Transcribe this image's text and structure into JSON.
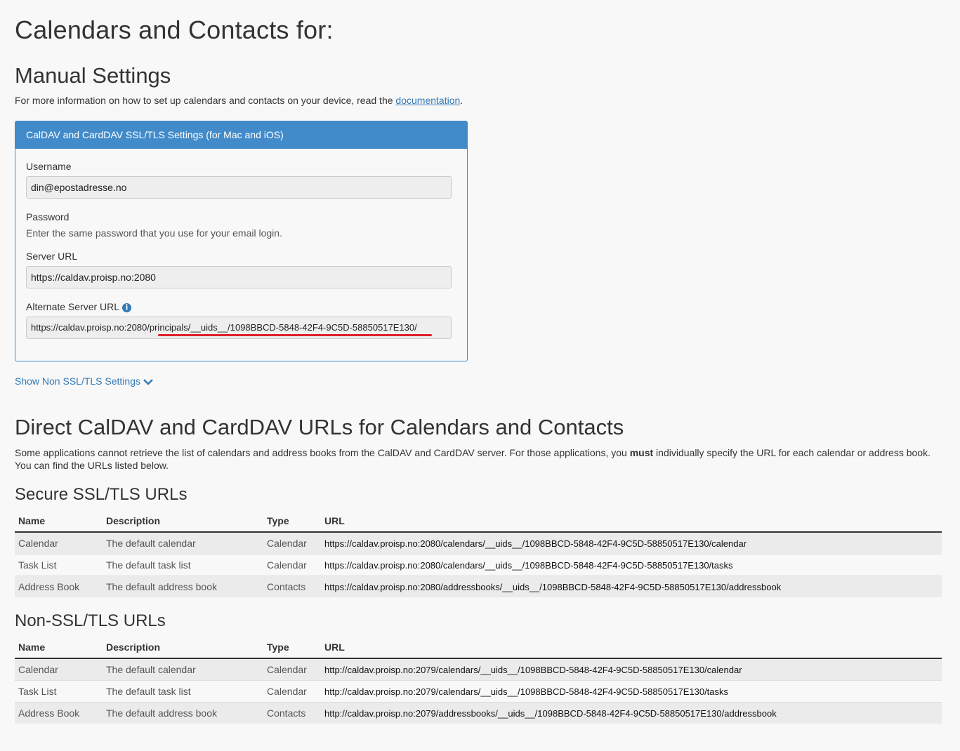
{
  "page_title": "Calendars and Contacts for:",
  "manual": {
    "heading": "Manual Settings",
    "intro_before": "For more information on how to set up calendars and contacts on your device, read the ",
    "intro_link": "documentation",
    "intro_after": "."
  },
  "panel": {
    "header": "CalDAV and CardDAV SSL/TLS Settings (for Mac and iOS)",
    "username_label": "Username",
    "username_value": "din@epostadresse.no",
    "password_label": "Password",
    "password_note": "Enter the same password that you use for your email login.",
    "server_url_label": "Server URL",
    "server_url_value": "https://caldav.proisp.no:2080",
    "alt_server_url_label": "Alternate Server URL",
    "alt_server_url_value": "https://caldav.proisp.no:2080/principals/__uids__/1098BBCD-5848-42F4-9C5D-58850517E130/",
    "info_icon": "info-icon",
    "underline_color": "#e0202a"
  },
  "toggle_label": "Show Non SSL/TLS Settings",
  "direct": {
    "heading": "Direct CalDAV and CardDAV URLs for Calendars and Contacts",
    "desc_before": "Some applications cannot retrieve the list of calendars and address books from the CalDAV and CardDAV server. For those applications, you ",
    "desc_bold": "must",
    "desc_after": " individually specify the URL for each calendar or address book. You can find the URLs listed below."
  },
  "columns": {
    "name": "Name",
    "description": "Description",
    "type": "Type",
    "url": "URL"
  },
  "secure": {
    "heading": "Secure SSL/TLS URLs",
    "rows": [
      {
        "name": "Calendar",
        "description": "The default calendar",
        "type": "Calendar",
        "url": "https://caldav.proisp.no:2080/calendars/__uids__/1098BBCD-5848-42F4-9C5D-58850517E130/calendar"
      },
      {
        "name": "Task List",
        "description": "The default task list",
        "type": "Calendar",
        "url": "https://caldav.proisp.no:2080/calendars/__uids__/1098BBCD-5848-42F4-9C5D-58850517E130/tasks"
      },
      {
        "name": "Address Book",
        "description": "The default address book",
        "type": "Contacts",
        "url": "https://caldav.proisp.no:2080/addressbooks/__uids__/1098BBCD-5848-42F4-9C5D-58850517E130/addressbook"
      }
    ]
  },
  "nonsecure": {
    "heading": "Non-SSL/TLS URLs",
    "rows": [
      {
        "name": "Calendar",
        "description": "The default calendar",
        "type": "Calendar",
        "url": "http://caldav.proisp.no:2079/calendars/__uids__/1098BBCD-5848-42F4-9C5D-58850517E130/calendar"
      },
      {
        "name": "Task List",
        "description": "The default task list",
        "type": "Calendar",
        "url": "http://caldav.proisp.no:2079/calendars/__uids__/1098BBCD-5848-42F4-9C5D-58850517E130/tasks"
      },
      {
        "name": "Address Book",
        "description": "The default address book",
        "type": "Contacts",
        "url": "http://caldav.proisp.no:2079/addressbooks/__uids__/1098BBCD-5848-42F4-9C5D-58850517E130/addressbook"
      }
    ]
  },
  "colors": {
    "primary": "#428bca",
    "link": "#337ab7",
    "background": "#f8f8f8",
    "stripe": "#ebebeb"
  }
}
